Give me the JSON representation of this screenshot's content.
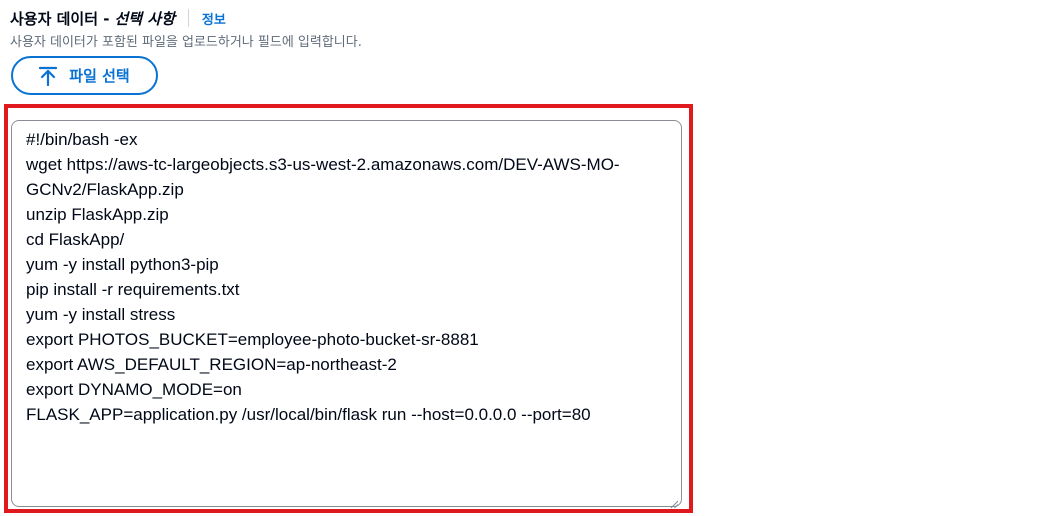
{
  "field": {
    "label_main": "사용자 데이터 -",
    "label_optional": "선택 사항",
    "info_link": "정보",
    "description": "사용자 데이터가 포함된 파일을 업로드하거나 필드에 입력합니다."
  },
  "file_button": {
    "icon": "upload-arrow-icon",
    "label": "파일 선택"
  },
  "user_data": {
    "value": "#!/bin/bash -ex\nwget https://aws-tc-largeobjects.s3-us-west-2.amazonaws.com/DEV-AWS-MO-GCNv2/FlaskApp.zip\nunzip FlaskApp.zip\ncd FlaskApp/\nyum -y install python3-pip\npip install -r requirements.txt\nyum -y install stress\nexport PHOTOS_BUCKET=employee-photo-bucket-sr-8881\nexport AWS_DEFAULT_REGION=ap-northeast-2\nexport DYNAMO_MODE=on\nFLASK_APP=application.py /usr/local/bin/flask run --host=0.0.0.0 --port=80"
  },
  "colors": {
    "accent": "#0972d3",
    "highlight": "#e0191f",
    "text": "#000716",
    "muted": "#5f6b7a"
  }
}
